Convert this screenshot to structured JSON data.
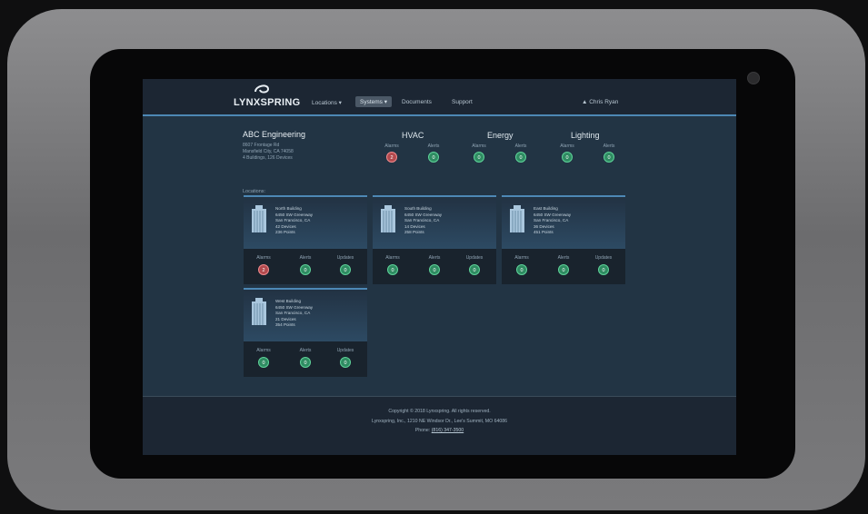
{
  "nav": {
    "logo_text": "LYNXSPRING",
    "links": [
      "Locations ▾",
      "Systems ▾",
      "Documents",
      "Support"
    ],
    "user": "▲ Chris Ryan"
  },
  "company": {
    "name": "ABC Engineering",
    "lines": [
      "8607 Frontage Rd",
      "Mansfield City, CA 74058",
      "4 Buildings, 126 Devices"
    ]
  },
  "systems": [
    {
      "title": "HVAC",
      "labels": [
        "Alarms",
        "Alerts"
      ],
      "counts": [
        "2",
        "0"
      ]
    },
    {
      "title": "Energy",
      "labels": [
        "Alarms",
        "Alerts"
      ],
      "counts": [
        "0",
        "0"
      ]
    },
    {
      "title": "Lighting",
      "labels": [
        "Alarms",
        "Alerts"
      ],
      "counts": [
        "0",
        "0"
      ]
    }
  ],
  "locations_heading": "Locations:",
  "card_labels": [
    "Alarms",
    "Alerts",
    "Updates"
  ],
  "buildings": [
    {
      "name": "North Building",
      "addr": "6450 SW Greenway",
      "city": "San Francisco, CA",
      "devices": "42 Devices",
      "points": "236 Points",
      "counts": [
        "2",
        "0",
        "0"
      ]
    },
    {
      "name": "South Building",
      "addr": "6450 SW Greenway",
      "city": "San Francisco, CA",
      "devices": "14 Devices",
      "points": "258 Points",
      "counts": [
        "0",
        "0",
        "0"
      ]
    },
    {
      "name": "East Building",
      "addr": "6450 SW Greenway",
      "city": "San Francisco, CA",
      "devices": "36 Devices",
      "points": "451 Points",
      "counts": [
        "0",
        "0",
        "0"
      ]
    },
    {
      "name": "West Building",
      "addr": "6450 SW Greenway",
      "city": "San Francisco, CA",
      "devices": "21 Devices",
      "points": "354 Points",
      "counts": [
        "0",
        "0",
        "0"
      ]
    }
  ],
  "footer": {
    "copyright": "Copyright © 2018 Lynxspring. All rights reserved.",
    "address": "Lynxspring, Inc., 1210 NE Windsor Dr., Lee's Summit, MO 64086",
    "phone_label": "Phone:",
    "phone": "(816) 347-3500"
  },
  "colors": {
    "accent": "#4d88b5",
    "alarm": "#b34a4e",
    "ok": "#2f8c62"
  }
}
